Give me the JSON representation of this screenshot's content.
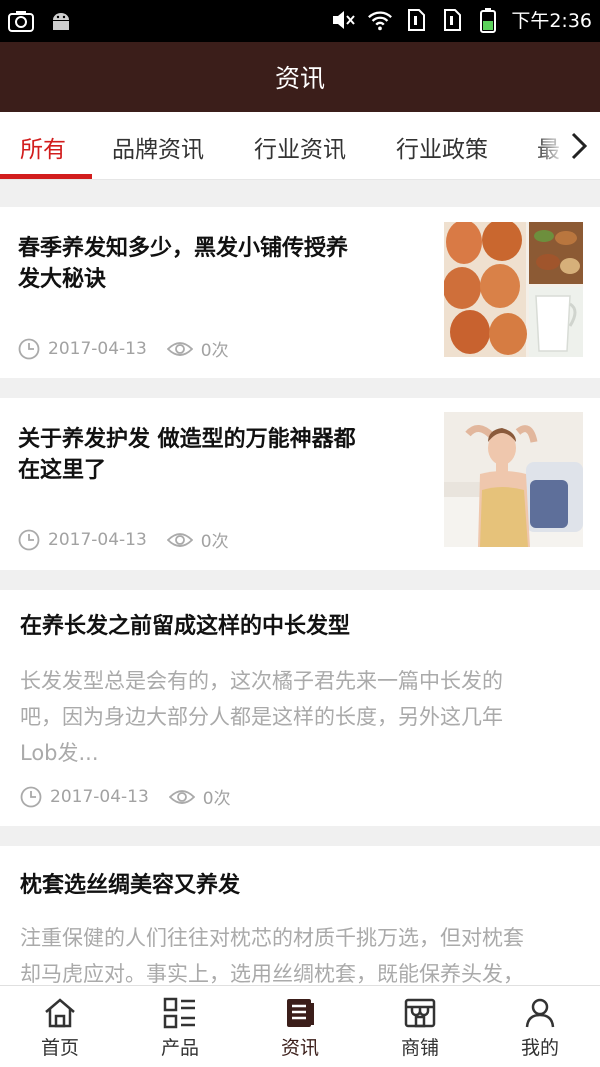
{
  "status_bar": {
    "time": "下午2:36",
    "icons": [
      "camera-icon",
      "android-icon",
      "mute-icon",
      "wifi-icon",
      "sim1-icon",
      "sim2-icon",
      "battery-icon"
    ]
  },
  "header": {
    "title": "资讯"
  },
  "tabs": [
    {
      "label": "所有",
      "active": true
    },
    {
      "label": "品牌资讯",
      "active": false
    },
    {
      "label": "行业资讯",
      "active": false
    },
    {
      "label": "行业政策",
      "active": false
    },
    {
      "label": "最",
      "active": false
    }
  ],
  "articles": [
    {
      "title_line1": "春季养发知多少，黑发小铺传授养",
      "title_line2": "发大秘诀",
      "date": "2017-04-13",
      "views": "0次",
      "thumbnail": "eggs-nuts-milk"
    },
    {
      "title_line1": "关于养发护发 做造型的万能神器都",
      "title_line2": "在这里了",
      "date": "2017-04-13",
      "views": "0次",
      "thumbnail": "woman-on-sofa"
    },
    {
      "title_line1": "在养长发之前留成这样的中长发型",
      "summary_line1": "长发发型总是会有的，这次橘子君先来一篇中长发的",
      "summary_line2": "吧，因为身边大部分人都是这样的长度，另外这几年",
      "summary_line3": "Lob发...",
      "date": "2017-04-13",
      "views": "0次"
    },
    {
      "title_line1": "枕套选丝绸美容又养发",
      "summary_line1": "注重保健的人们往往对枕芯的材质千挑万选，但对枕套",
      "summary_line2": "却马虎应对。事实上，选用丝绸枕套，既能保养头发，"
    }
  ],
  "bottom_nav": [
    {
      "label": "首页",
      "icon": "home-icon",
      "active": false
    },
    {
      "label": "产品",
      "icon": "grid-list-icon",
      "active": false
    },
    {
      "label": "资讯",
      "icon": "news-icon",
      "active": true
    },
    {
      "label": "商铺",
      "icon": "store-icon",
      "active": false
    },
    {
      "label": "我的",
      "icon": "user-icon",
      "active": false
    }
  ],
  "colors": {
    "header_bg": "#3b1e1a",
    "accent": "#d21d1d",
    "meta_text": "#a2a2a2"
  }
}
